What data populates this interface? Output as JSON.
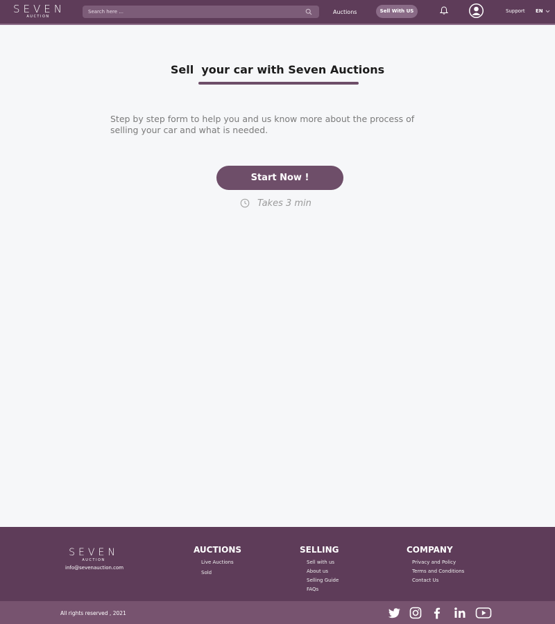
{
  "header": {
    "logo_main": "SEVEN",
    "logo_sub": "AUCTION",
    "search_placeholder": "Search here ...",
    "nav_auctions": "Auctions",
    "sell_button": "Sell With US",
    "support": "Support",
    "language": "EN"
  },
  "main": {
    "title": "Sell  your car with Seven Auctions",
    "description": "Step by step form to help you and us know more about the process of selling your car and what is needed.",
    "start_button": "Start Now !",
    "time_note": "Takes 3 min"
  },
  "footer": {
    "logo_main": "SEVEN",
    "logo_sub": "AUCTION",
    "email": "info@sevenauction.com",
    "auctions": {
      "heading": "AUCTIONS",
      "links": [
        "Live Auctions",
        "Sold"
      ]
    },
    "selling": {
      "heading": "SELLING",
      "links": [
        "Sell with us",
        "About us",
        "Selling Guide",
        "FAQs"
      ]
    },
    "company": {
      "heading": "COMPANY",
      "links": [
        "Privacy and Policy",
        "Terms and Conditions",
        "Contact Us"
      ]
    },
    "copyright": "All  rights reserved , 2021",
    "social": [
      "twitter-icon",
      "instagram-icon",
      "facebook-icon",
      "linkedin-icon",
      "youtube-icon"
    ]
  },
  "colors": {
    "brand": "#5e3c59",
    "accent": "#6e4e69",
    "bottom_bar": "#77536f"
  }
}
